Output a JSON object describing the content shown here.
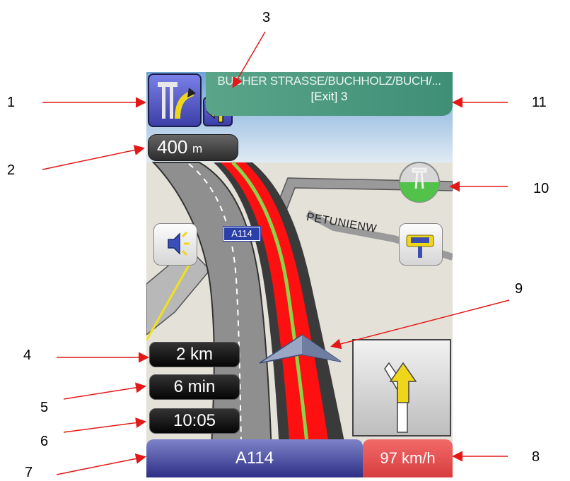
{
  "callouts": [
    "1",
    "2",
    "3",
    "4",
    "5",
    "6",
    "7",
    "8",
    "9",
    "10",
    "11"
  ],
  "sign": {
    "street": "BUCHER STRASSE/BUCHHOLZ/BUCH/...",
    "exit": "[Exit] 3"
  },
  "distance_to_turn": {
    "value": "400",
    "unit": "m"
  },
  "map": {
    "road_shield": "A114",
    "street_name": "PETUNIENW"
  },
  "stats": {
    "remaining_distance": "2 km",
    "remaining_time": "6 min",
    "arrival_time": "10:05"
  },
  "bottom": {
    "road": "A114",
    "speed": "97 km/h"
  },
  "colors": {
    "route": "#ff0000",
    "route_center": "#8bd44a",
    "sign": "#4a9a80",
    "road_bar": "#3a3d9a",
    "speed_bar": "#e34a4a",
    "arrow": "#e31818"
  },
  "icons": [
    "motorway-junction-icon",
    "turn-left-icon",
    "speaker-icon",
    "poi-icon",
    "compass-icon",
    "position-arrow-icon",
    "lane-guidance-icon"
  ]
}
